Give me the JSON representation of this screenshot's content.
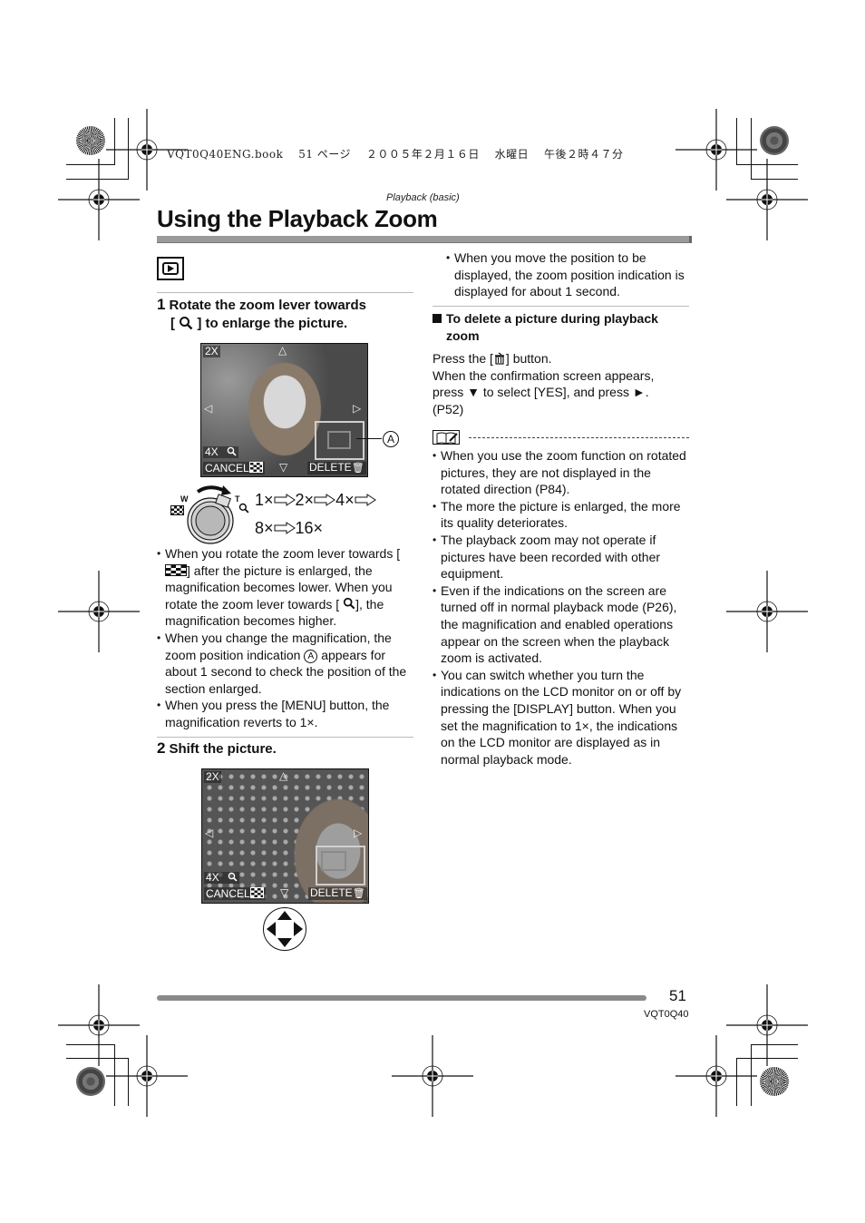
{
  "print_header": {
    "text": "VQT0Q40ENG.book　 51 ページ 　２００５年２月１６日　 水曜日　 午後２時４７分"
  },
  "section_label": "Playback (basic)",
  "page_title": "Using the Playback Zoom",
  "mode_icon": "playback-mode-icon",
  "steps": [
    {
      "number": "1",
      "title_line1": "Rotate the zoom lever towards",
      "title_line2_pre": "[",
      "title_line2_icon": "magnify-icon",
      "title_line2_post": "] to enlarge the picture."
    },
    {
      "number": "2",
      "title": "Shift the picture."
    }
  ],
  "lcd_screen": {
    "magnification": "2X",
    "next_magnification": "4X",
    "cancel_label": "CANCEL",
    "delete_label": "DELETE",
    "callout_label": "A"
  },
  "zoom_lever": {
    "wide_label": "W",
    "tele_label": "T",
    "sequence_line1": [
      "1×",
      "2×",
      "4×"
    ],
    "sequence_line2": [
      "8×",
      "16×"
    ]
  },
  "left_bullets": [
    {
      "parts": [
        "When you rotate the zoom lever towards",
        "[",
        "] after the picture is enlarged, the magnification becomes lower. When you rotate the zoom lever towards [",
        "], the magnification becomes higher."
      ]
    },
    {
      "pre": "When you change the magnification, the zoom position indication ",
      "marker": "A",
      "post": " appears for about 1 second to check the position of the section enlarged."
    },
    {
      "text": "When you press the [MENU] button, the magnification reverts to 1×."
    }
  ],
  "right_top_bullet": "When you move the position to be displayed, the zoom position indication is displayed for about 1 second.",
  "delete_section": {
    "heading_line1": "To delete a picture during playback",
    "heading_line2": "zoom",
    "press_pre": "Press the [",
    "press_post": "] button.",
    "line2": "When the confirmation screen appears,",
    "line3": "press ▼ to select [YES], and press ►.",
    "line4": "(P52)"
  },
  "notes": [
    "When you use the zoom function on rotated pictures, they are not displayed in the rotated direction (P84).",
    "The more the picture is enlarged, the more its quality deteriorates.",
    "The playback zoom may not operate if pictures have been recorded with other equipment.",
    "Even if the indications on the screen are turned off in normal playback mode (P26), the magnification and enabled operations appear on the screen when the playback zoom is activated.",
    "You can switch whether you turn the indications on the LCD monitor on or off by pressing the [DISPLAY] button. When you set the magnification to 1×, the indications on the LCD monitor are displayed as in normal playback mode."
  ],
  "footer": {
    "page_number": "51",
    "model_code": "VQT0Q40"
  }
}
